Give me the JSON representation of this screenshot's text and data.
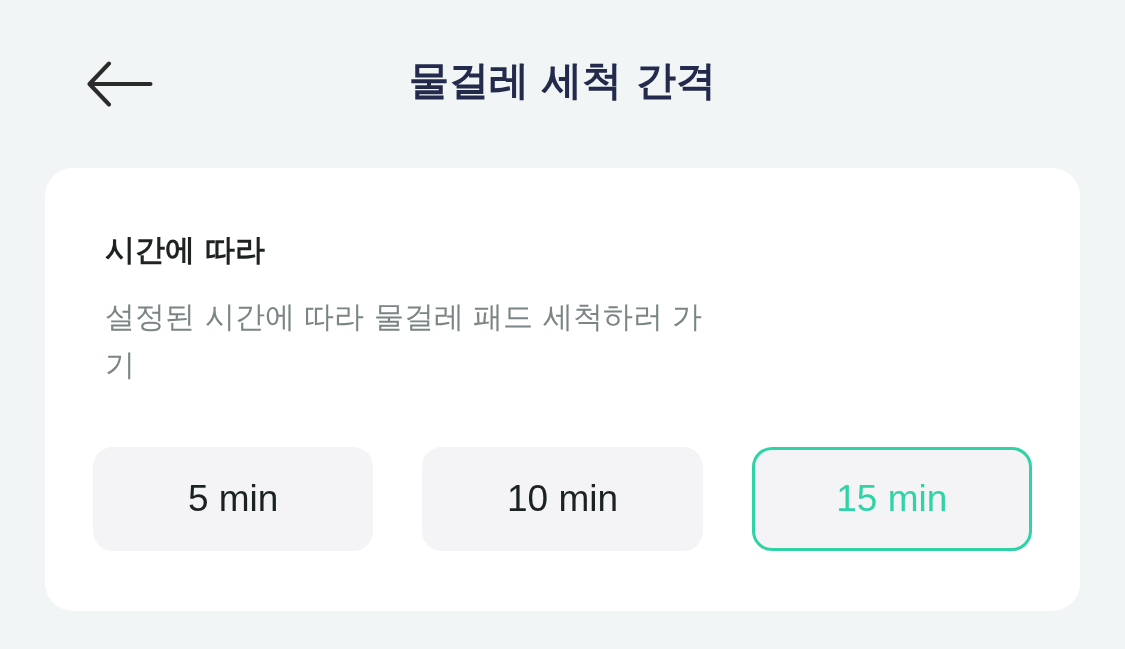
{
  "header": {
    "title": "물걸레 세척 간격"
  },
  "section": {
    "title": "시간에 따라",
    "description": "설정된 시간에 따라 물걸레 패드 세척하러 가기",
    "options": [
      {
        "label": "5 min",
        "selected": false
      },
      {
        "label": "10 min",
        "selected": false
      },
      {
        "label": "15 min",
        "selected": true
      }
    ]
  }
}
